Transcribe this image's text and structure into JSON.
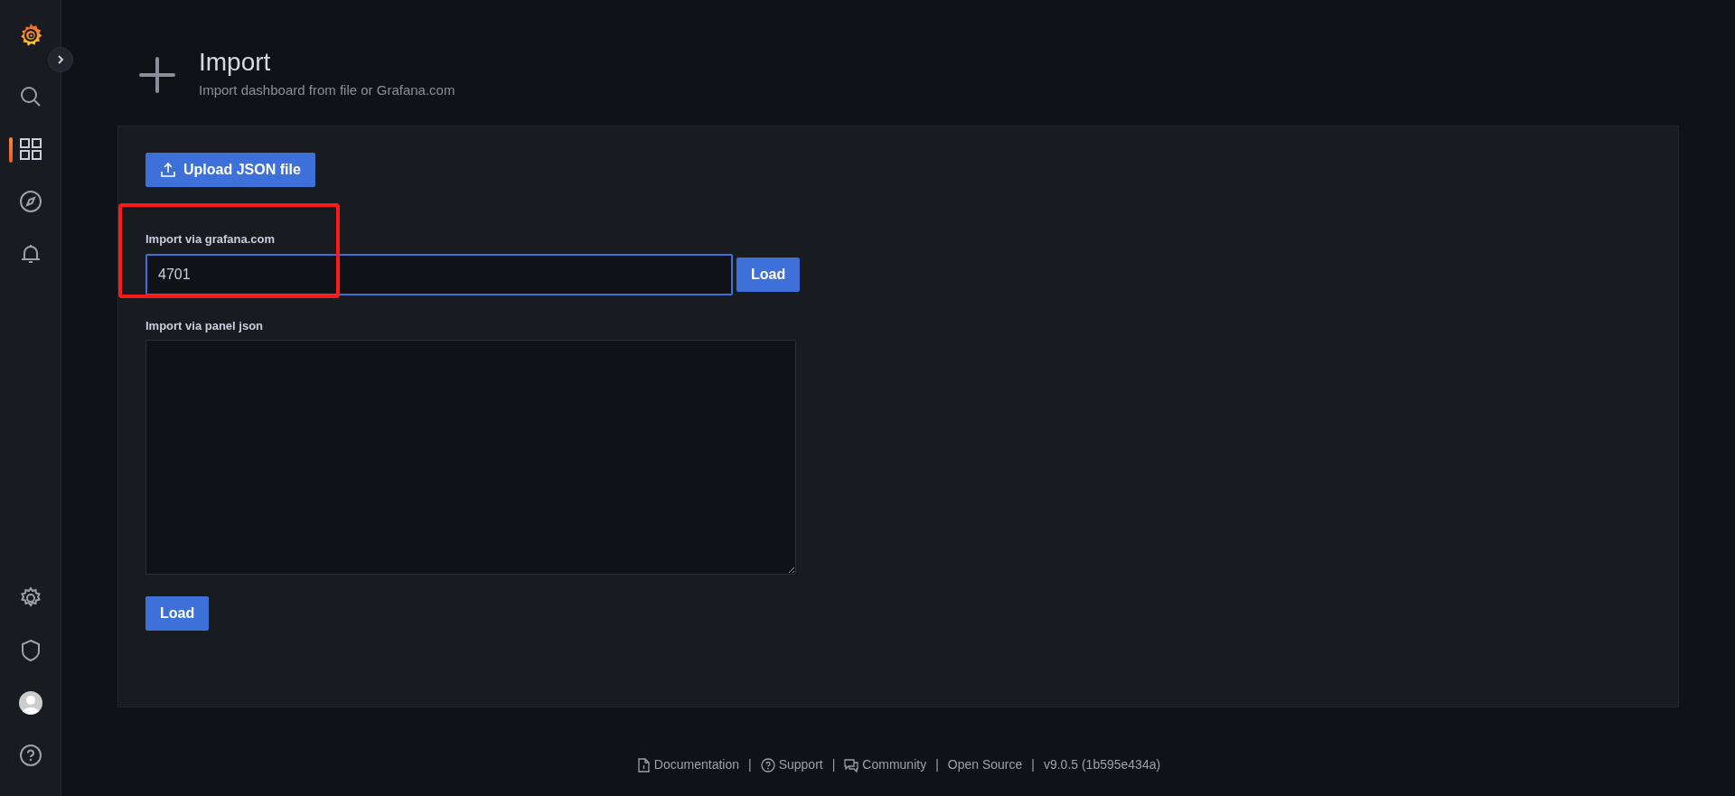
{
  "sidebar": {
    "top_items": [
      {
        "kind": "search",
        "selected": false
      },
      {
        "kind": "dashboards",
        "selected": true
      },
      {
        "kind": "explore",
        "selected": false
      },
      {
        "kind": "alerting",
        "selected": false
      }
    ],
    "bottom_items": [
      {
        "kind": "settings",
        "selected": false
      },
      {
        "kind": "shield",
        "selected": false
      },
      {
        "kind": "profile",
        "selected": false
      },
      {
        "kind": "help",
        "selected": false
      }
    ]
  },
  "header": {
    "title": "Import",
    "subtitle": "Import dashboard from file or Grafana.com"
  },
  "upload_button": "Upload JSON file",
  "grafana_import": {
    "label": "Import via grafana.com",
    "value": "4701",
    "focused": true,
    "highlighted": true,
    "button": "Load"
  },
  "panel_json": {
    "label": "Import via panel json",
    "button": "Load"
  },
  "footer": [
    {
      "kind": "docs",
      "text": "Documentation"
    },
    {
      "kind": "separator",
      "text": "|"
    },
    {
      "kind": "support",
      "text": "Support"
    },
    {
      "kind": "separator",
      "text": "|"
    },
    {
      "kind": "community",
      "text": "Community"
    },
    {
      "kind": "separator",
      "text": "|"
    },
    {
      "kind": "none",
      "text": "Open Source"
    },
    {
      "kind": "separator",
      "text": "|"
    },
    {
      "kind": "none",
      "text": "v9.0.5 (1b595e434a)"
    }
  ]
}
